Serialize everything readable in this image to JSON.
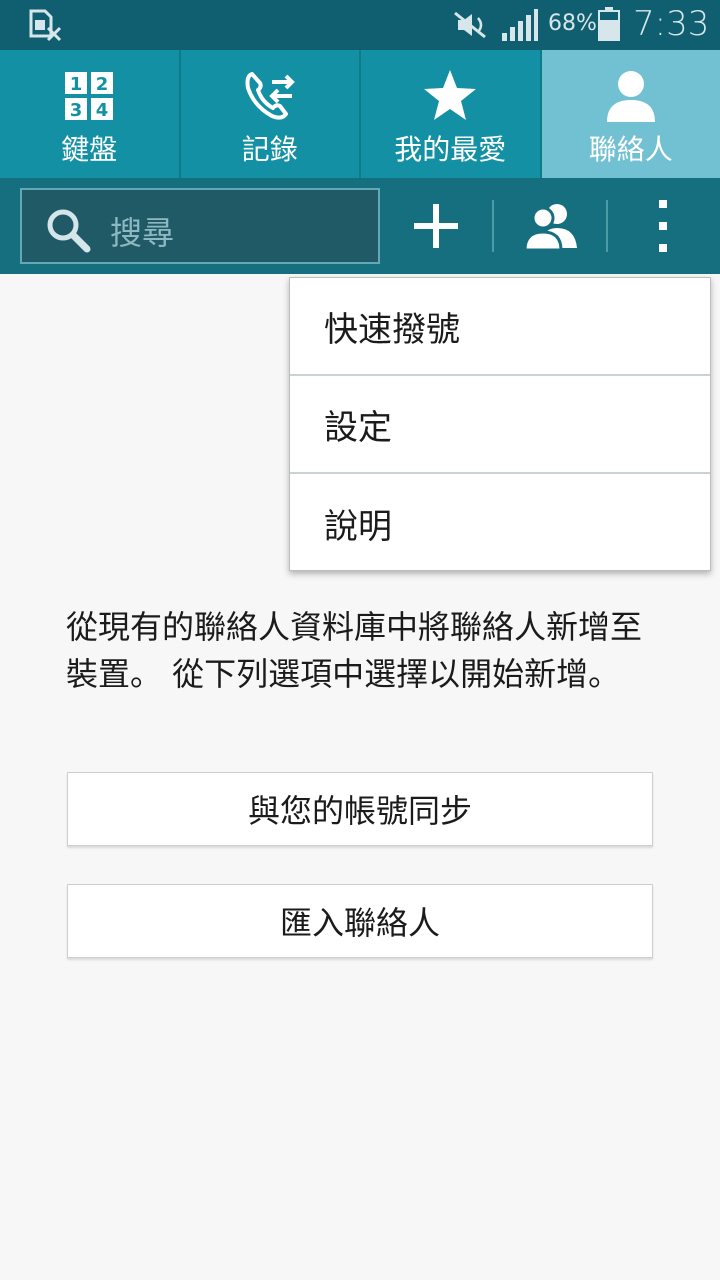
{
  "status_bar": {
    "battery_percent": "68%",
    "time": "7:33",
    "icons": [
      "sim-card-off-icon",
      "mute-icon",
      "signal-icon",
      "battery-icon"
    ]
  },
  "tabs": [
    {
      "label": "鍵盤",
      "icon": "keypad-icon",
      "active": false
    },
    {
      "label": "記錄",
      "icon": "call-log-icon",
      "active": false
    },
    {
      "label": "我的最愛",
      "icon": "star-icon",
      "active": false
    },
    {
      "label": "聯絡人",
      "icon": "person-icon",
      "active": true
    }
  ],
  "toolbar": {
    "search_placeholder": "搜尋",
    "icons": [
      "search-icon",
      "add-icon",
      "groups-icon",
      "more-options-icon"
    ]
  },
  "menu": {
    "items": [
      "快速撥號",
      "設定",
      "說明"
    ]
  },
  "main": {
    "intro": "從現有的聯絡人資料庫中將聯絡人新增至裝置。 從下列選項中選擇以開始新增。",
    "sync_button": "與您的帳號同步",
    "import_button": "匯入聯絡人"
  },
  "colors": {
    "status_bar": "#0f5f70",
    "tab_bar": "#1490a4",
    "tab_active": "#72c1d3",
    "toolbar": "#166f7f"
  }
}
